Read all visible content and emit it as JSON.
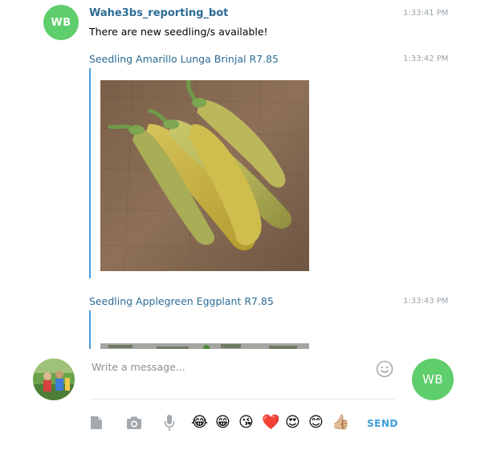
{
  "messages": [
    {
      "avatar_initials": "WB",
      "sender": "Wahe3bs_reporting_bot",
      "time": "1:33:41 PM",
      "text": "There are new seedling/s available!"
    },
    {
      "link_text": "Seedling Amarillo Lunga Brinjal R7.85",
      "time": "1:33:42 PM",
      "image": "photo of yellow-green brinjal pods on burlap"
    },
    {
      "link_text": "Seedling Applegreen Eggplant R7.85",
      "time": "1:33:43 PM",
      "image": "photo of applegreen eggplant (partially visible)"
    }
  ],
  "composer": {
    "placeholder": "Write a message...",
    "send_label": "SEND",
    "self_avatar_initials": "WB",
    "icons": [
      "document-icon",
      "camera-icon",
      "microphone-icon",
      "smiley-icon"
    ],
    "emojis": [
      "😂",
      "😁",
      "😘",
      "❤️",
      "😍",
      "😊",
      "👍🏼"
    ]
  },
  "colors": {
    "accent": "#3aa0d9",
    "sender": "#2c6b94",
    "avatar_bg": "#5fce6c"
  }
}
